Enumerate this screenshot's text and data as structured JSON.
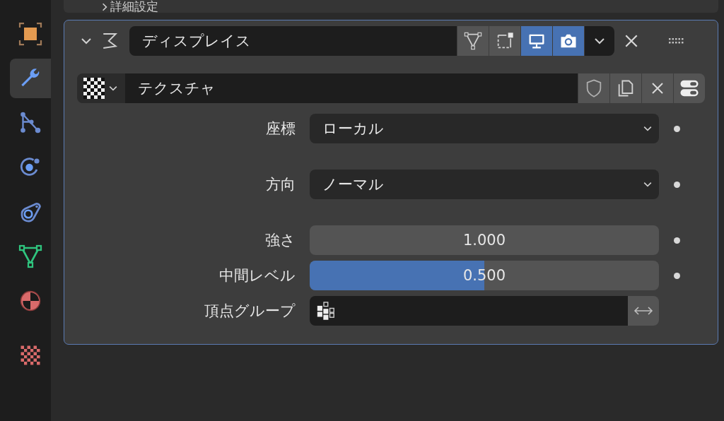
{
  "top_panel": {
    "label": "詳細設定",
    "expanded": false
  },
  "sidebar": {
    "tabs": [
      {
        "kind": "object",
        "selected": false
      },
      {
        "kind": "modifier",
        "selected": true
      },
      {
        "kind": "particles",
        "selected": false
      },
      {
        "kind": "physics",
        "selected": false
      },
      {
        "kind": "constraints",
        "selected": false
      },
      {
        "kind": "data",
        "selected": false
      },
      {
        "kind": "material",
        "selected": false
      },
      {
        "kind": "texture",
        "selected": false
      }
    ]
  },
  "modifier": {
    "expanded": true,
    "name": "ディスプレイス",
    "toggles": [
      {
        "kind": "edit-mode",
        "selected": false
      },
      {
        "kind": "cage",
        "selected": false
      },
      {
        "kind": "viewport",
        "selected": true
      },
      {
        "kind": "render",
        "selected": true
      }
    ],
    "texture": {
      "name": "テクスチャ"
    },
    "properties": [
      {
        "kind": "dropdown",
        "label": "座標",
        "value": "ローカル"
      },
      {
        "kind": "dropdown",
        "label": "方向",
        "value": "ノーマル"
      },
      {
        "kind": "number",
        "label": "強さ",
        "value": "1.000"
      },
      {
        "kind": "slider",
        "label": "中間レベル",
        "value": "0.500",
        "level": 0.5
      },
      {
        "kind": "group",
        "label": "頂点グループ"
      }
    ]
  }
}
